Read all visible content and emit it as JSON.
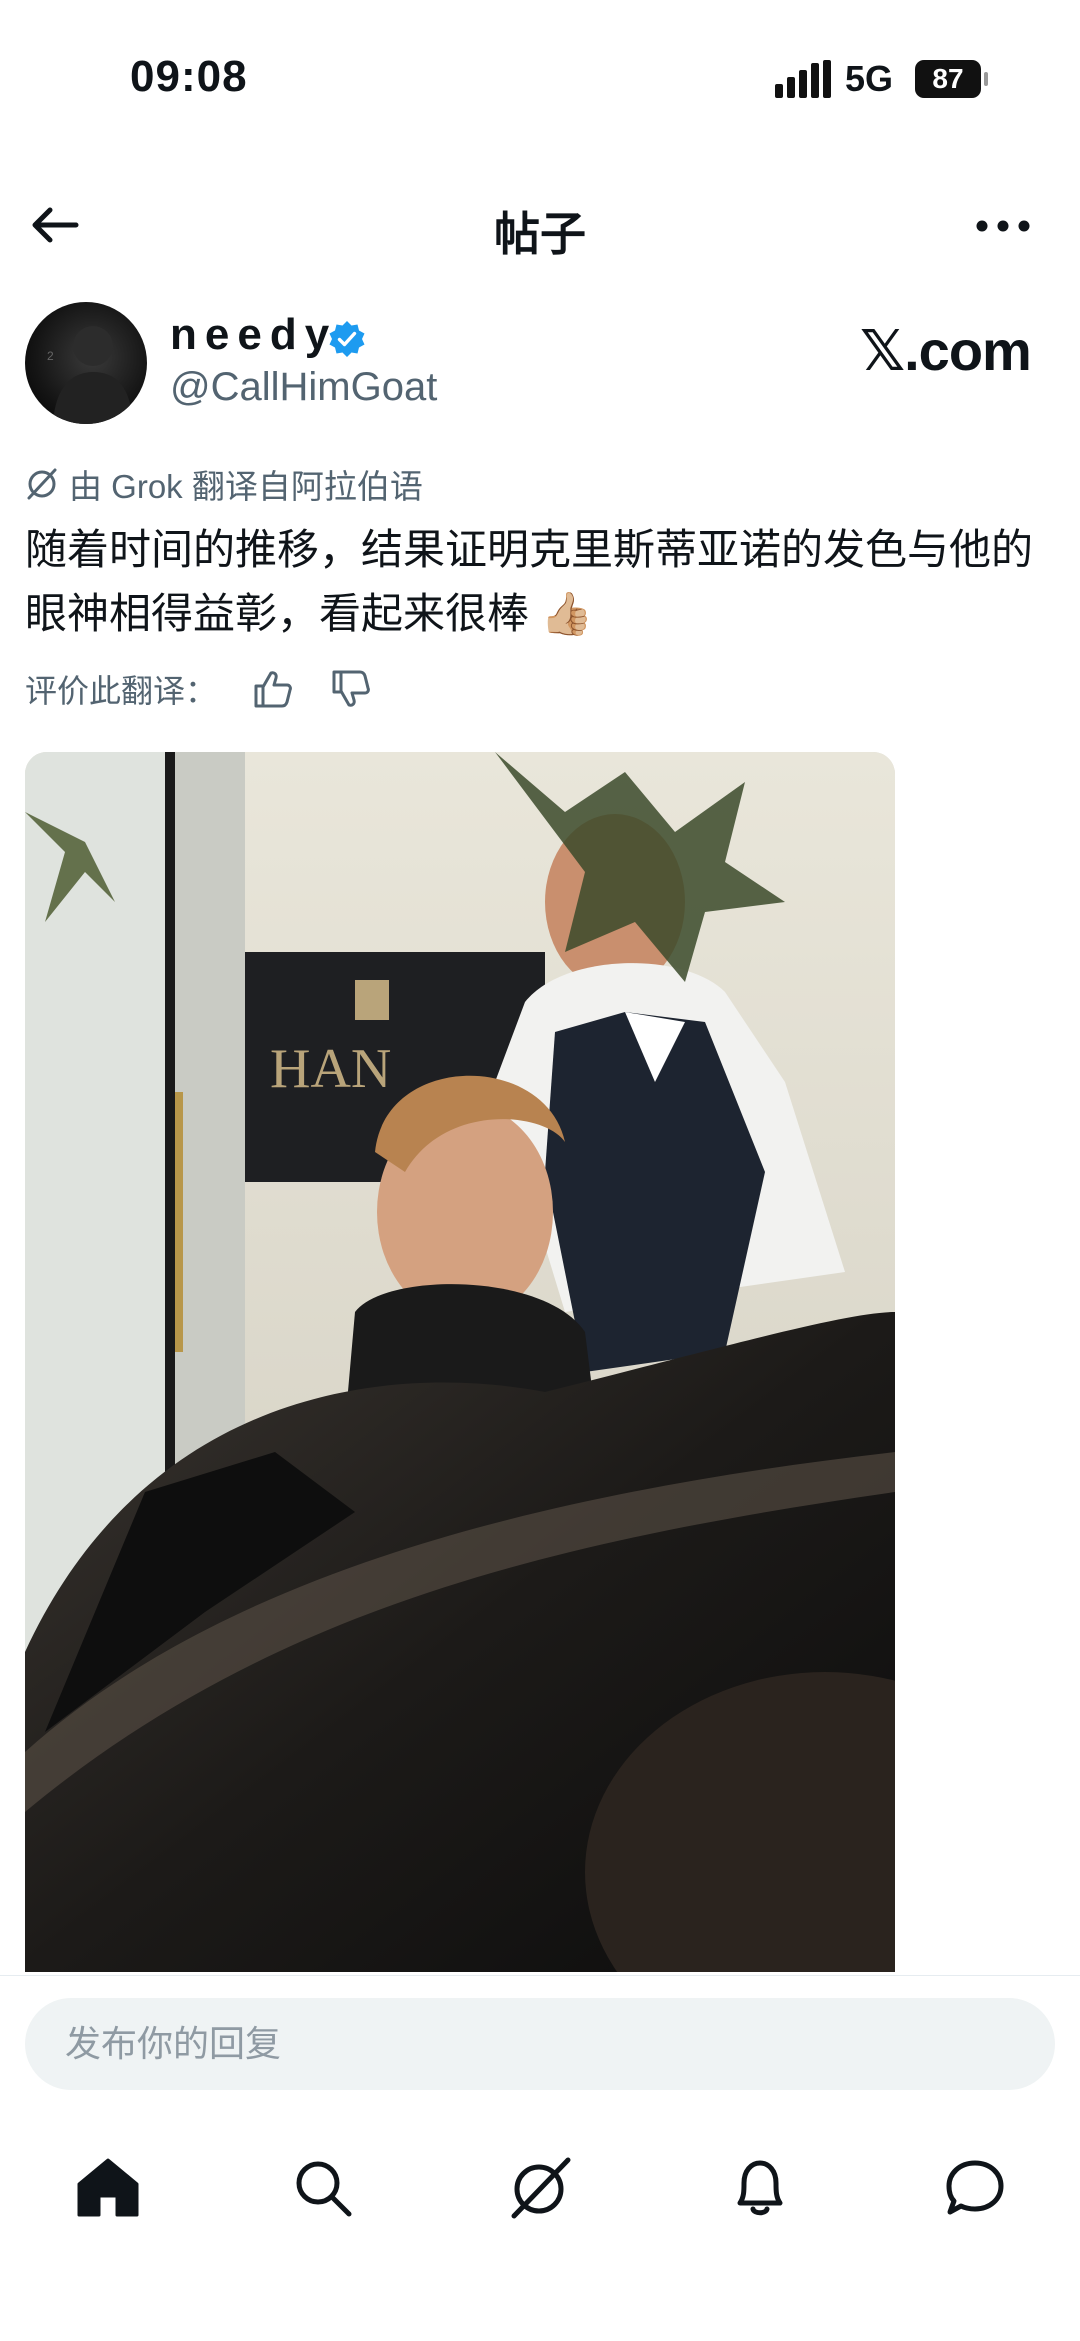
{
  "status_bar": {
    "time": "09:08",
    "network": "5G",
    "battery": "87"
  },
  "header": {
    "title": "帖子"
  },
  "post": {
    "author": {
      "display_name": "needy",
      "handle": "@CallHimGoat"
    },
    "brand": "𝕏.com",
    "translation_note": "由 Grok 翻译自阿拉伯语",
    "text": "随着时间的推移，结果证明克里斯蒂亚诺的发色与他的眼神相得益彰，看起来很棒 👍🏼",
    "rate_label": "评价此翻译："
  },
  "reply": {
    "placeholder": "发布你的回复"
  },
  "nav": [
    "home-icon",
    "search-icon",
    "grok-icon",
    "notifications-icon",
    "messages-icon"
  ],
  "colors": {
    "accent": "#1d9bf0",
    "text": "#0f1419",
    "secondary": "#536471",
    "input_bg": "#eff3f4"
  }
}
